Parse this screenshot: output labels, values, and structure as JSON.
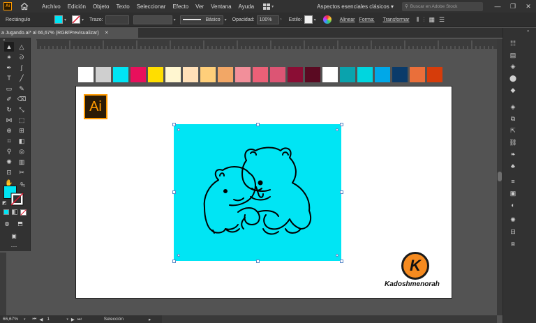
{
  "menubar": {
    "app_badge": "Ai",
    "items": [
      "Archivo",
      "Edición",
      "Objeto",
      "Texto",
      "Seleccionar",
      "Efecto",
      "Ver",
      "Ventana",
      "Ayuda"
    ],
    "workspace": "Aspectos esenciales clásicos",
    "search_placeholder": "Buscar en Adobe Stock",
    "window_controls": [
      "—",
      "❐",
      "✕"
    ]
  },
  "control_bar": {
    "object_type": "Rectángulo",
    "stroke_label": "Trazo:",
    "stroke_style": "Básico",
    "opacity_label": "Opacidad:",
    "opacity_value": "100%",
    "style_label": "Estilo:",
    "align_link": "Alinear",
    "shape_link": "Forma:",
    "transform_link": "Transformar",
    "fill_color": "#00e5f4"
  },
  "document_tab": {
    "title": "a Jugando.ai* al 66,67% (RGB/Previsualizar)",
    "close": "✕"
  },
  "canvas": {
    "swatch_colors": [
      "#ffffff",
      "#cfcfcf",
      "#00e5f4",
      "#e8105c",
      "#ffde00",
      "#fff6d0",
      "#ffe0b8",
      "#ffcf7a",
      "#f2a766",
      "#f28f9a",
      "#eb6077",
      "#dc5574",
      "#8a0d34",
      "#5a0a22",
      "#ffffff",
      "#0aa3ad",
      "#00d6df",
      "#00a8e8",
      "#0a3b6a",
      "#ea6f3a",
      "#d63c0a"
    ],
    "ai_badge": "Ai",
    "artwork_fill": "#00e5f4",
    "brand_letter": "K",
    "brand_name": "Kadoshmenorah"
  },
  "status_bar": {
    "zoom": "66,67%",
    "artboard_number": "1",
    "mode": "Selección"
  }
}
